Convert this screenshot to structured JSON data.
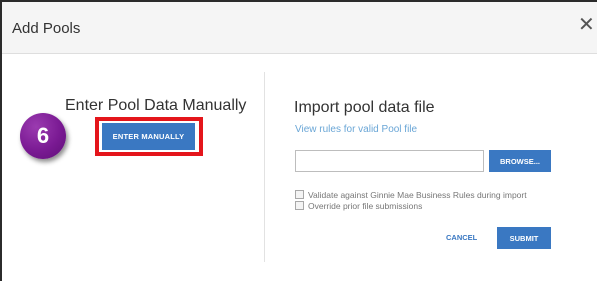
{
  "dialog": {
    "title": "Add Pools",
    "close_glyph": "✕"
  },
  "manual": {
    "heading": "Enter Pool Data Manually",
    "button_label": "ENTER MANUALLY",
    "step_number": "6"
  },
  "import": {
    "heading": "Import pool data file",
    "rules_link": "View rules for valid Pool file",
    "file_value": "",
    "browse_label": "BROWSE...",
    "options": [
      {
        "label": "Validate against Ginnie Mae Business Rules during import",
        "checked": false
      },
      {
        "label": "Override prior file submissions",
        "checked": false
      }
    ],
    "cancel_label": "CANCEL",
    "submit_label": "SUBMIT"
  },
  "colors": {
    "primary_button": "#3a78c2",
    "link": "#6aa6d6",
    "highlight_border": "#e4151b",
    "step_badge": "#7a1a93"
  },
  "icons": {
    "close": "close-icon"
  }
}
